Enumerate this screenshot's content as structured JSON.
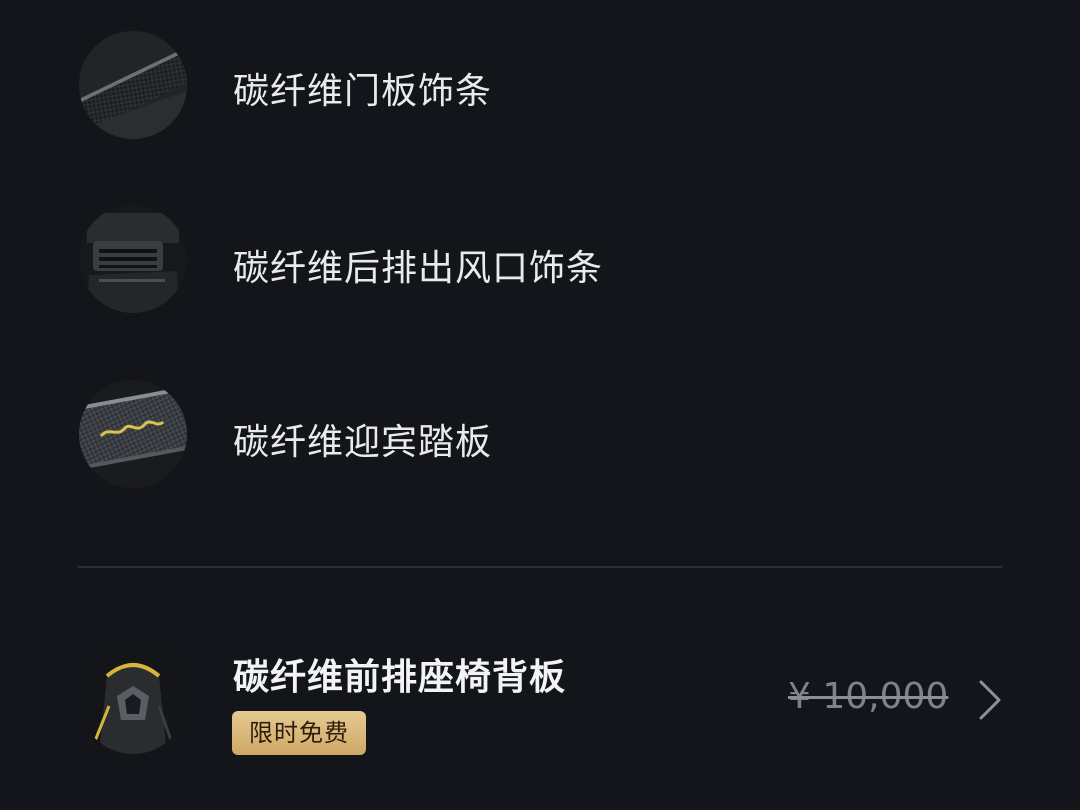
{
  "items": [
    {
      "label": "碳纤维门板饰条",
      "icon": "carbon-door-trim-thumbnail"
    },
    {
      "label": "碳纤维后排出风口饰条",
      "icon": "carbon-rear-vent-trim-thumbnail"
    },
    {
      "label": " 碳纤维迎宾踏板",
      "icon": "carbon-sill-plate-thumbnail"
    }
  ],
  "featured": {
    "label": "碳纤维前排座椅背板",
    "badge": "限时免费",
    "price": "¥ 10,000",
    "icon": "carbon-seat-back-thumbnail"
  },
  "colors": {
    "background": "#13151b",
    "text": "#e9eaee",
    "badge_gold": "#dcb979",
    "price_muted": "#7e828c"
  }
}
